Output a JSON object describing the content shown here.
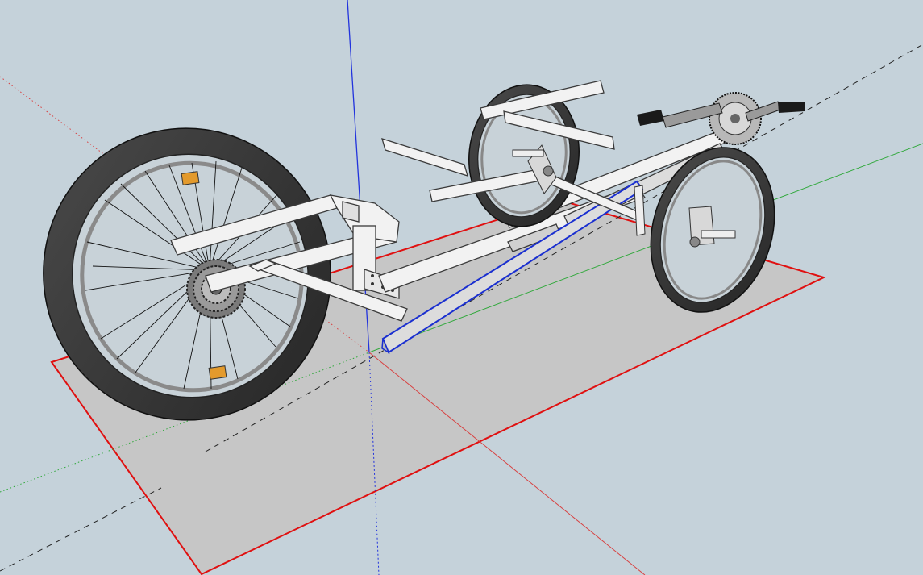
{
  "viewport": {
    "background": "#c5d2da",
    "ground_color": "#c6c6c6",
    "selection_color": "#e01010",
    "selected_member_color": "#1a2fd0"
  },
  "axes": {
    "red": "#d84040",
    "green": "#2fa83a",
    "blue": "#2233dd",
    "inference_dashed": "#222222"
  },
  "model": {
    "frame_color": "#f2f2f2",
    "frame_edge": "#3a3a3a",
    "tire_color": "#3a3a3a",
    "reflector_color": "#e39a2c",
    "metal_color": "#bcbcbc"
  }
}
